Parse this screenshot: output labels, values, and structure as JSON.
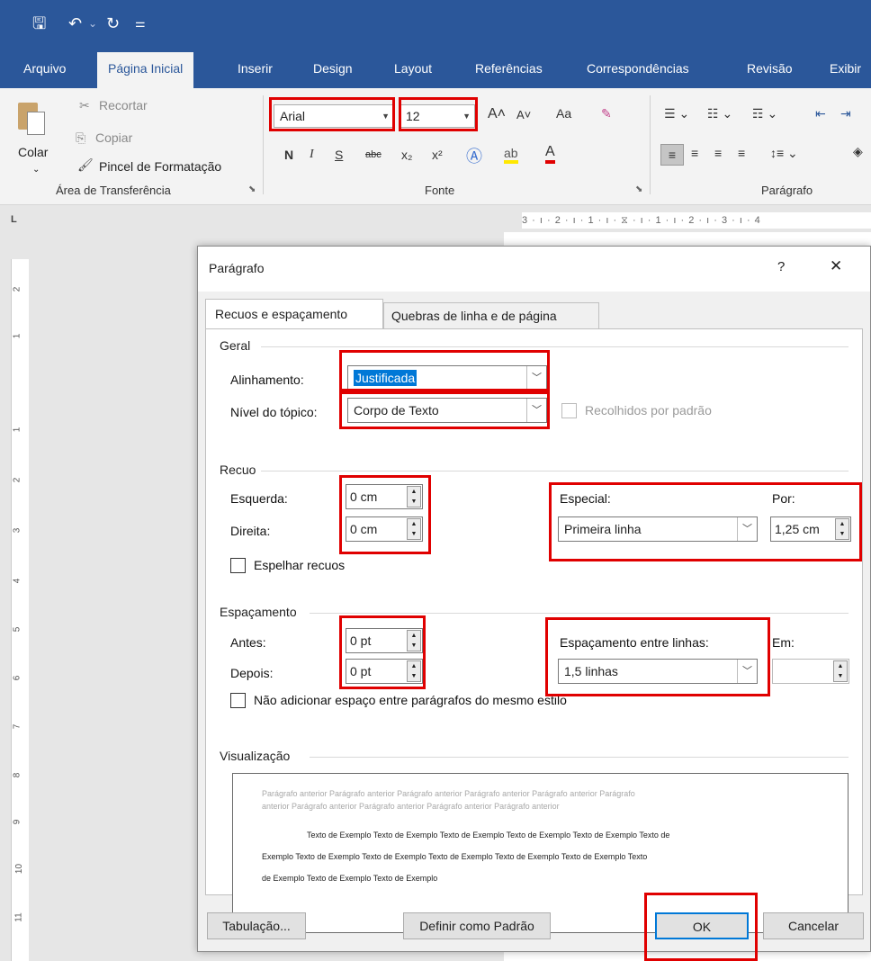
{
  "quick_access": {
    "save": "🖫",
    "undo": "↶",
    "undo_dd": "⌄",
    "redo": "↻",
    "customize": "⚌"
  },
  "tabs": [
    "Arquivo",
    "Página Inicial",
    "Inserir",
    "Design",
    "Layout",
    "Referências",
    "Correspondências",
    "Revisão",
    "Exibir"
  ],
  "clipboard": {
    "cut": "Recortar",
    "copy": "Copiar",
    "paste": "Colar",
    "format_painter": "Pincel de Formatação",
    "group": "Área de Transferência"
  },
  "font": {
    "name": "Arial",
    "size": "12",
    "group": "Fonte",
    "bold": "N",
    "italic": "I",
    "underline": "S",
    "strike": "abc",
    "sub": "x₂",
    "sup": "x²",
    "grow": "A˄",
    "shrink": "A˅",
    "case": "Aa",
    "clear": "✎"
  },
  "paragraph_group": {
    "group": "Parágrafo"
  },
  "ruler": {
    "h": "3 · ı · 2 · ı · 1 · ı · ⧖ · ı · 1 · ı · 2 · ı · 3 · ı · 4",
    "v": [
      "2",
      "1",
      "1",
      "2",
      "3",
      "4",
      "5",
      "6",
      "7",
      "8",
      "9",
      "10",
      "11"
    ],
    "corner": "L"
  },
  "dialog": {
    "title": "Parágrafo",
    "help": "?",
    "close": "✕",
    "tab_active": "Recuos e espaçamento",
    "tab_other": "Quebras de linha e de página",
    "geral": "Geral",
    "alinhamento_label": "Alinhamento:",
    "alinhamento_value": "Justificada",
    "nivel_label": "Nível do tópico:",
    "nivel_value": "Corpo de Texto",
    "recolhidos": "Recolhidos por padrão",
    "recuo": "Recuo",
    "esquerda_label": "Esquerda:",
    "esquerda_value": "0 cm",
    "direita_label": "Direita:",
    "direita_value": "0 cm",
    "especial_label": "Especial:",
    "especial_value": "Primeira linha",
    "por_label": "Por:",
    "por_value": "1,25 cm",
    "espelhar": "Espelhar recuos",
    "espacamento": "Espaçamento",
    "antes_label": "Antes:",
    "antes_value": "0 pt",
    "depois_label": "Depois:",
    "depois_value": "0 pt",
    "entre_linhas_label": "Espaçamento entre linhas:",
    "entre_linhas_value": "1,5 linhas",
    "em_label": "Em:",
    "em_value": "",
    "nao_adicionar": "Não adicionar espaço entre parágrafos do mesmo estilo",
    "visualizacao": "Visualização",
    "prev_line1": "Parágrafo anterior Parágrafo anterior Parágrafo anterior Parágrafo anterior Parágrafo anterior Parágrafo",
    "prev_line2": "anterior Parágrafo anterior Parágrafo anterior Parágrafo anterior Parágrafo anterior",
    "sample1": "Texto de Exemplo Texto de Exemplo Texto de Exemplo Texto de Exemplo Texto de Exemplo Texto de",
    "sample2": "Exemplo Texto de Exemplo Texto de Exemplo Texto de Exemplo Texto de Exemplo Texto de Exemplo Texto",
    "sample3": "de Exemplo Texto de Exemplo Texto de Exemplo",
    "tabulacao": "Tabulação...",
    "definir": "Definir como Padrão",
    "ok": "OK",
    "cancelar": "Cancelar"
  }
}
